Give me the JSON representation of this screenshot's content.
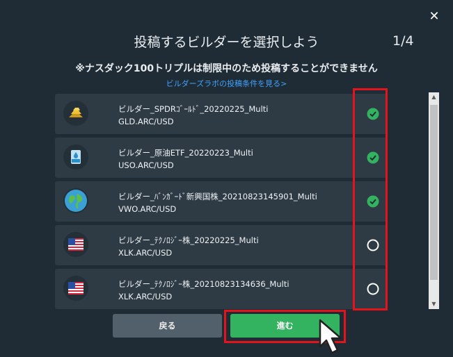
{
  "dialog": {
    "close_label": "✕",
    "title": "投稿するビルダーを選択しよう",
    "step": "1/4",
    "notice": "※ナスダック100トリプルは制限中のため投稿することができません",
    "conditions_link": "ビルダーズラボの投稿条件を見る>"
  },
  "builders": [
    {
      "name": "ビルダー_SPDRｺﾞｰﾙﾄﾞ_20220225_Multi",
      "ticker": "GLD.ARC/USD",
      "icon": "gold-bars-icon",
      "selected": true
    },
    {
      "name": "ビルダー_原油ETF_20220223_Multi",
      "ticker": "USO.ARC/USD",
      "icon": "oil-barrel-icon",
      "selected": true
    },
    {
      "name": "ビルダー_ﾊﾞﾝｶﾞｰﾄﾞ新興国株_20210823145901_Multi",
      "ticker": "VWO.ARC/USD",
      "icon": "globe-icon",
      "selected": true
    },
    {
      "name": "ビルダー_ﾃｸﾉﾛｼﾞｰ株_20220225_Multi",
      "ticker": "XLK.ARC/USD",
      "icon": "us-flag-icon",
      "selected": false
    },
    {
      "name": "ビルダー_ﾃｸﾉﾛｼﾞｰ株_20210823134636_Multi",
      "ticker": "XLK.ARC/USD",
      "icon": "us-flag-icon",
      "selected": false
    }
  ],
  "buttons": {
    "back": "戻る",
    "next": "進む"
  },
  "colors": {
    "background": "#1f2c36",
    "row": "#2e3b45",
    "selected_check": "#33b35f",
    "highlight": "#e3141c",
    "link": "#3fa3ff"
  }
}
